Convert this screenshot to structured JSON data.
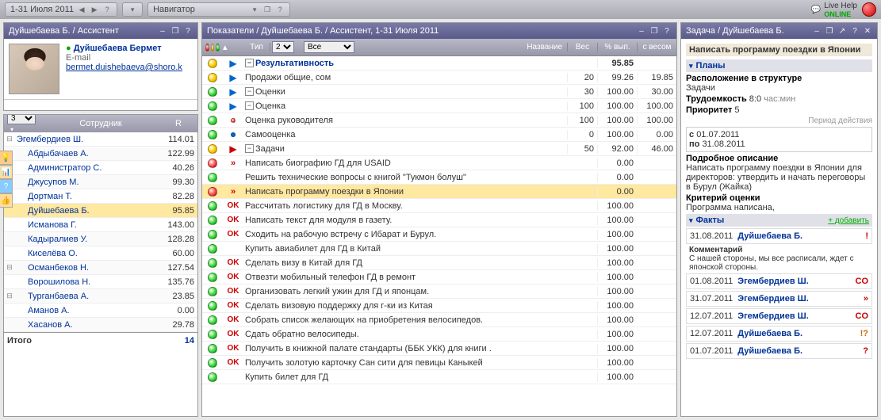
{
  "topbar": {
    "period": "1-31 Июля 2011",
    "nav_label": "Навигатор",
    "live_help": "Live Help",
    "online": "ONLINE"
  },
  "profile_panel": {
    "title": "Дуйшебаева Б. / Ассистент",
    "name": "Дуйшебаева Бермет",
    "email_label": "E-mail",
    "email": "bermet.duishebaeva@shoro.k"
  },
  "employees": {
    "num_select": "3",
    "col_name": "Сотрудник",
    "col_r": "R",
    "rows": [
      {
        "exp": "-",
        "name": "Эгембердиев Ш.",
        "r": "114.01",
        "indent": false,
        "hi": false
      },
      {
        "exp": "",
        "name": "Абдыбачаев А.",
        "r": "122.99",
        "indent": true,
        "hi": false
      },
      {
        "exp": "",
        "name": "Администратор С.",
        "r": "40.26",
        "indent": true,
        "hi": false
      },
      {
        "exp": "",
        "name": "Джусупов М.",
        "r": "99.30",
        "indent": true,
        "hi": false
      },
      {
        "exp": "",
        "name": "Дортман Т.",
        "r": "82.28",
        "indent": true,
        "hi": false
      },
      {
        "exp": "",
        "name": "Дуйшебаева Б.",
        "r": "95.85",
        "indent": true,
        "hi": true
      },
      {
        "exp": "",
        "name": "Исманова Г.",
        "r": "143.00",
        "indent": true,
        "hi": false
      },
      {
        "exp": "",
        "name": "Кадыралиев У.",
        "r": "128.28",
        "indent": true,
        "hi": false
      },
      {
        "exp": "",
        "name": "Киселёва О.",
        "r": "60.00",
        "indent": true,
        "hi": false
      },
      {
        "exp": "-",
        "name": "Османбеков Н.",
        "r": "127.54",
        "indent": true,
        "hi": false
      },
      {
        "exp": "",
        "name": "Ворошилова Н.",
        "r": "135.76",
        "indent": true,
        "hi": false
      },
      {
        "exp": "-",
        "name": "Турганбаева А.",
        "r": "23.85",
        "indent": true,
        "hi": false
      },
      {
        "exp": "",
        "name": "Аманов А.",
        "r": "0.00",
        "indent": true,
        "hi": false
      },
      {
        "exp": "",
        "name": "Хасанов А.",
        "r": "29.78",
        "indent": true,
        "hi": false
      }
    ],
    "total_label": "Итого",
    "total_value": "14"
  },
  "indicators": {
    "title": "Показатели / Дуйшебаева Б. / Ассистент, 1-31 Июля 2011",
    "type_col": "Тип",
    "num_sel": "2",
    "filter_sel": "Все",
    "name_col": "Название",
    "weight_col": "Вес",
    "pct_col": "% вып.",
    "wpct_col": "с весом",
    "rows": [
      {
        "dot": "yellow",
        "arr": "▶",
        "arrc": "blue",
        "pad": 1,
        "exp": "-",
        "name": "Результативность",
        "bold": true,
        "w": "",
        "p": "95.85",
        "wp": ""
      },
      {
        "dot": "yellow",
        "arr": "▶",
        "arrc": "blue",
        "pad": 2,
        "exp": "",
        "name": "Продажи общие, сом",
        "w": "20",
        "p": "99.26",
        "wp": "19.85"
      },
      {
        "dot": "green",
        "arr": "▶",
        "arrc": "blue",
        "pad": 2,
        "exp": "-",
        "name": "Оценки",
        "w": "30",
        "p": "100.00",
        "wp": "30.00"
      },
      {
        "dot": "green",
        "arr": "▶",
        "arrc": "blue",
        "pad": 3,
        "exp": "-",
        "name": "Оценка",
        "w": "100",
        "p": "100.00",
        "wp": "100.00"
      },
      {
        "dot": "green",
        "arr": "•",
        "arrc": "red",
        "pad": 4,
        "exp": "",
        "name": "Оценка руководителя",
        "w": "100",
        "p": "100.00",
        "wp": "100.00",
        "small": true
      },
      {
        "dot": "green",
        "arr": "•",
        "arrc": "blue",
        "pad": 4,
        "exp": "",
        "name": "Самооценка",
        "w": "0",
        "p": "100.00",
        "wp": "0.00",
        "small": true
      },
      {
        "dot": "yellow",
        "arr": "▶",
        "arrc": "red",
        "pad": 2,
        "exp": "-",
        "name": "Задачи",
        "w": "50",
        "p": "92.00",
        "wp": "46.00"
      },
      {
        "dot": "red",
        "arr": "»",
        "arrc": "redb",
        "pad": 3,
        "exp": "",
        "name": "Написать биографию ГД для USAID",
        "w": "",
        "p": "0.00",
        "wp": ""
      },
      {
        "dot": "green",
        "arr": "",
        "arrc": "",
        "pad": 3,
        "exp": "",
        "name": "Решить технические вопросы с книгой \"Тукмон болуш\"",
        "w": "",
        "p": "0.00",
        "wp": ""
      },
      {
        "dot": "red",
        "arr": "»",
        "arrc": "redb",
        "pad": 3,
        "exp": "",
        "name": "Написать программу поездки в Японии",
        "w": "",
        "p": "0.00",
        "wp": "",
        "hi": true
      },
      {
        "dot": "green",
        "arr": "OK",
        "arrc": "ok",
        "pad": 3,
        "exp": "",
        "name": "Рассчитать логистику для ГД в Москву.",
        "w": "",
        "p": "100.00",
        "wp": ""
      },
      {
        "dot": "green",
        "arr": "OK",
        "arrc": "ok",
        "pad": 3,
        "exp": "",
        "name": "Написать текст для модуля в газету.",
        "w": "",
        "p": "100.00",
        "wp": ""
      },
      {
        "dot": "green",
        "arr": "OK",
        "arrc": "ok",
        "pad": 3,
        "exp": "",
        "name": "Сходить на рабочую встречу с Ибарат и Бурул.",
        "w": "",
        "p": "100.00",
        "wp": ""
      },
      {
        "dot": "green",
        "arr": "",
        "arrc": "",
        "pad": 3,
        "exp": "",
        "name": "Купить авиабилет для ГД в Китай",
        "w": "",
        "p": "100.00",
        "wp": ""
      },
      {
        "dot": "green",
        "arr": "OK",
        "arrc": "ok",
        "pad": 3,
        "exp": "",
        "name": "Сделать визу в Китай для ГД",
        "w": "",
        "p": "100.00",
        "wp": ""
      },
      {
        "dot": "green",
        "arr": "OK",
        "arrc": "ok",
        "pad": 3,
        "exp": "",
        "name": "Отвезти мобильный телефон ГД в ремонт",
        "w": "",
        "p": "100.00",
        "wp": ""
      },
      {
        "dot": "green",
        "arr": "OK",
        "arrc": "ok",
        "pad": 3,
        "exp": "",
        "name": "Организовать легкий ужин для ГД и японцам.",
        "w": "",
        "p": "100.00",
        "wp": ""
      },
      {
        "dot": "green",
        "arr": "OK",
        "arrc": "ok",
        "pad": 3,
        "exp": "",
        "name": "Сделать визовую поддержку для г-ки из Китая",
        "w": "",
        "p": "100.00",
        "wp": ""
      },
      {
        "dot": "green",
        "arr": "OK",
        "arrc": "ok",
        "pad": 3,
        "exp": "",
        "name": "Собрать список желающих на приобретения велосипедов.",
        "w": "",
        "p": "100.00",
        "wp": ""
      },
      {
        "dot": "green",
        "arr": "OK",
        "arrc": "ok",
        "pad": 3,
        "exp": "",
        "name": "Сдать обратно велосипеды.",
        "w": "",
        "p": "100.00",
        "wp": ""
      },
      {
        "dot": "green",
        "arr": "OK",
        "arrc": "ok",
        "pad": 3,
        "exp": "",
        "name": "Получить в книжной палате стандарты (ББК УКК) для книги .",
        "w": "",
        "p": "100.00",
        "wp": ""
      },
      {
        "dot": "green",
        "arr": "OK",
        "arrc": "ok",
        "pad": 3,
        "exp": "",
        "name": "Получить золотую карточку Сан сити для певицы Каныкей",
        "w": "",
        "p": "100.00",
        "wp": ""
      },
      {
        "dot": "green",
        "arr": "",
        "arrc": "",
        "pad": 3,
        "exp": "",
        "name": "Купить билет для ГД",
        "w": "",
        "p": "100.00",
        "wp": ""
      }
    ]
  },
  "task": {
    "title": "Задача / Дуйшебаева Б.",
    "name": "Написать программу поездки в Японии",
    "plans_head": "Планы",
    "loc_label": "Расположение в структуре",
    "loc_value": "Задачи",
    "effort_label": "Трудоемкость",
    "effort_value": "8:0",
    "effort_unit": "час:мин",
    "priority_label": "Приоритет",
    "priority_value": "5",
    "period_label": "Период действия",
    "date_from_label": "с",
    "date_from": "01.07.2011",
    "date_to_label": "по",
    "date_to": "31.08.2011",
    "desc_label": "Подробное описание",
    "desc_text": "Написать программу поездки в Японии для директоров: утвердить и начать переговоры в Бурул (Жайка)",
    "crit_label": "Критерий оценки",
    "crit_text": "Программа написана,",
    "facts_head": "Факты",
    "add_label": "добавить",
    "facts": [
      {
        "date": "31.08.2011",
        "name": "Дуйшебаева Б.",
        "sym": "!",
        "cls": "excl",
        "comment": "Комментарий",
        "ctext": "С нашей стороны, мы все расписали, ждет с японской стороны."
      },
      {
        "date": "01.08.2011",
        "name": "Эгембердиев Ш.",
        "sym": "CO",
        "cls": "co"
      },
      {
        "date": "31.07.2011",
        "name": "Эгембердиев Ш.",
        "sym": "»",
        "cls": "co"
      },
      {
        "date": "12.07.2011",
        "name": "Эгембердиев Ш.",
        "sym": "CO",
        "cls": "co"
      },
      {
        "date": "12.07.2011",
        "name": "Дуйшебаева Б.",
        "sym": "!?",
        "cls": "excq"
      },
      {
        "date": "01.07.2011",
        "name": "Дуйшебаева Б.",
        "sym": "?",
        "cls": "q"
      }
    ]
  }
}
